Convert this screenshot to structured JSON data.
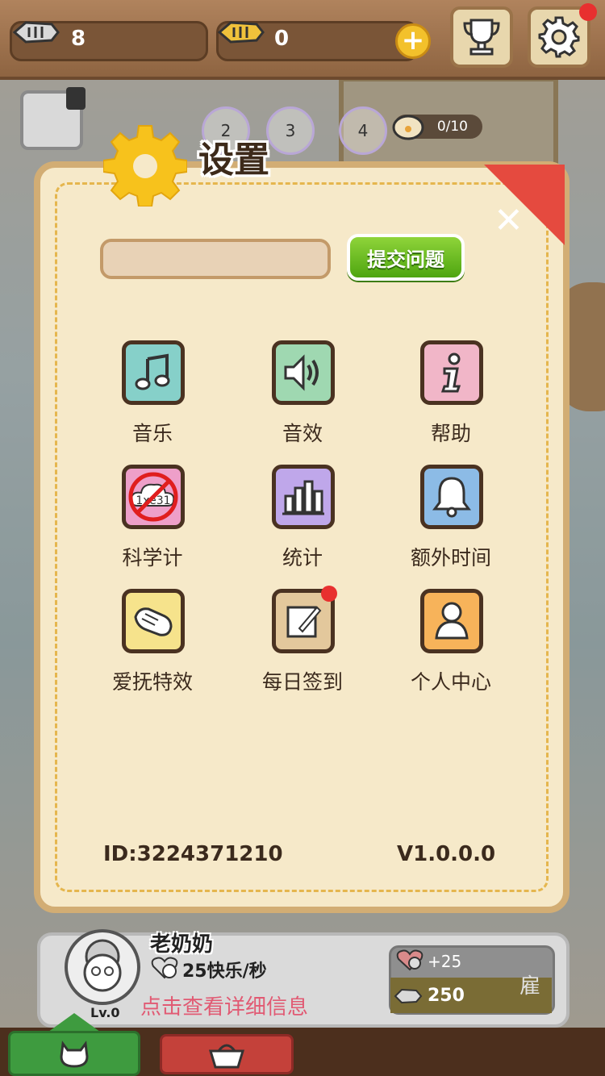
{
  "topbar": {
    "fish_bones_count": "8",
    "gold_fish_count": "0",
    "plus_label": "+",
    "trophy_icon": "trophy-icon",
    "settings_icon": "gear-icon"
  },
  "scene": {
    "bubbles": [
      "2",
      "3",
      "4"
    ],
    "paw_progress": "0/10"
  },
  "dialog": {
    "title": "设置",
    "close_label": "✕",
    "input_value": "",
    "submit_label": "提交问题",
    "options": [
      {
        "label": "音乐",
        "icon": "music-note-icon",
        "color": "#86d0c9"
      },
      {
        "label": "音效",
        "icon": "speaker-icon",
        "color": "#9fd8b1"
      },
      {
        "label": "帮助",
        "icon": "info-icon",
        "color": "#f1b6c8"
      },
      {
        "label": "科学计",
        "icon": "cloud-no-icon",
        "color": "#ee9fc9",
        "cloud_text": "1xe31"
      },
      {
        "label": "统计",
        "icon": "bar-chart-icon",
        "color": "#bfa7ea"
      },
      {
        "label": "额外时间",
        "icon": "bell-icon",
        "color": "#8cbbe6"
      },
      {
        "label": "爱抚特效",
        "icon": "petting-hand-icon",
        "color": "#f6e38c"
      },
      {
        "label": "每日签到",
        "icon": "note-pencil-icon",
        "color": "#e3c89c"
      },
      {
        "label": "个人中心",
        "icon": "person-icon",
        "color": "#f7b35a"
      }
    ],
    "id_text": "ID:3224371210",
    "version": "V1.0.0.0"
  },
  "character": {
    "name": "老奶奶",
    "level": "Lv.0",
    "rate": "25快乐/秒",
    "detail_link": "点击查看详细信息",
    "hire_bonus": "+25",
    "hire_cost": "250",
    "hire_label": "雇"
  },
  "tabs": {
    "cat_icon": "cat-icon",
    "shop_icon": "basket-icon"
  }
}
